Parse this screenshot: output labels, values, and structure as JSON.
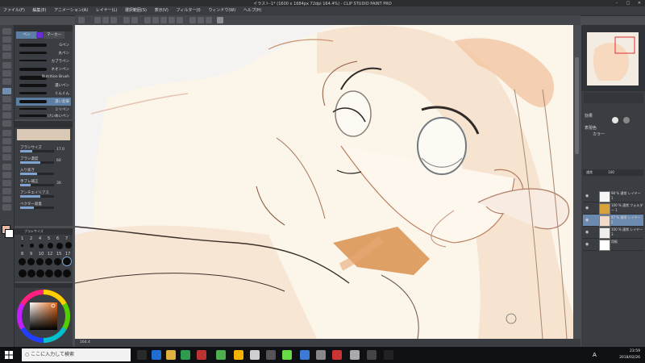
{
  "window": {
    "title": "イラスト-1* (1600 x 1684px 72dpi 164.4%) - CLIP STUDIO PAINT PRO",
    "minimize": "–",
    "maximize": "□",
    "close": "✕"
  },
  "menu": [
    "ファイル(F)",
    "編集(E)",
    "アニメーション(A)",
    "レイヤー(L)",
    "選択範囲(S)",
    "表示(V)",
    "フィルター(I)",
    "ウィンドウ(W)",
    "ヘルプ(H)"
  ],
  "subtool": {
    "tab_pen": "ペン",
    "tab_marker": "マーカー",
    "brushes": [
      "Gペン",
      "丸ペン",
      "カブラペン",
      "ネオンペン",
      "Nutrition Brush",
      "濃いペン",
      "ぐんぐん",
      "濃い鉛筆",
      "ミリペン",
      "けいめいペン"
    ]
  },
  "toolprop": {
    "props": [
      {
        "label": "ブラシサイズ",
        "value": "17.0",
        "fraction": 0.35
      },
      {
        "label": "ブラシ濃度",
        "value": "60",
        "fraction": 0.6
      },
      {
        "label": "入り抜き",
        "value": "",
        "fraction": 0.5
      },
      {
        "label": "手ブレ補正",
        "value": "30",
        "fraction": 0.3
      },
      {
        "label": "アンチエイリアス",
        "value": "",
        "fraction": 0.6
      },
      {
        "label": "ベクター吸着",
        "value": "",
        "fraction": 0.4
      }
    ]
  },
  "brushsize": {
    "title": "ブラシサイズ",
    "row1": [
      "1",
      "2",
      "4",
      "5",
      "6",
      "7"
    ],
    "row2": [
      "8",
      "9",
      "10",
      "12",
      "15",
      "17"
    ]
  },
  "layers": {
    "blend_mode": "通常",
    "opacity": "100",
    "items": [
      {
        "name": "98 % 通常 レイヤー 1",
        "visible": true,
        "selected": false
      },
      {
        "name": "100 % 通常 フォルダー 1",
        "visible": true,
        "selected": false
      },
      {
        "name": "47 % 通常 レイヤー 2",
        "visible": true,
        "selected": true
      },
      {
        "name": "100 % 通常 レイヤー 3",
        "visible": true,
        "selected": false
      },
      {
        "name": "用紙",
        "visible": true,
        "selected": false
      }
    ]
  },
  "layerprop": {
    "effect_label": "効果",
    "color_label": "表現色",
    "color_value": "カラー"
  },
  "statusbar": {
    "zoom": "164.4"
  },
  "taskbar": {
    "search_placeholder": "ここに入力して検索",
    "time": "23:59",
    "date": "2018/02/26",
    "ime": "A"
  }
}
